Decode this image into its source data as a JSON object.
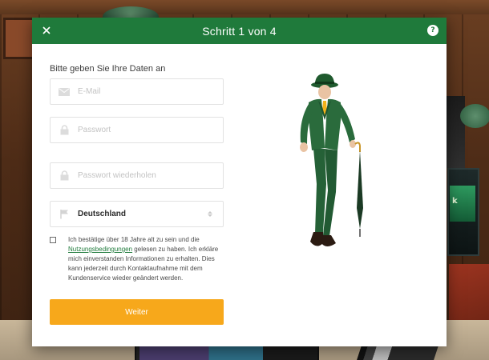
{
  "modal": {
    "title": "Schritt 1 von 4",
    "close_icon": "close-icon",
    "help_icon": "help-icon"
  },
  "form": {
    "heading": "Bitte geben Sie Ihre Daten an",
    "email": {
      "placeholder": "E-Mail",
      "value": "",
      "icon": "envelope-icon"
    },
    "password": {
      "placeholder": "Passwort",
      "value": "",
      "icon": "lock-icon"
    },
    "password_repeat": {
      "placeholder": "Passwort wiederholen",
      "value": "",
      "icon": "lock-icon"
    },
    "country": {
      "value": "Deutschland",
      "icon": "flag-icon"
    },
    "consent": {
      "checked": false,
      "text_before": "Ich bestätige über 18 Jahre alt zu sein und die ",
      "link": "Nutzungsbedingungen",
      "text_after": " gelesen zu haben. Ich erkläre mich einverstanden Informationen zu erhalten. Dies kann jederzeit durch Kontaktaufnahme mit dem Kundenservice wieder geändert werden."
    },
    "submit_label": "Weiter"
  },
  "colors": {
    "header_green": "#1f7a3b",
    "button_orange": "#f7a81b",
    "link_green": "#1f7a3b"
  }
}
